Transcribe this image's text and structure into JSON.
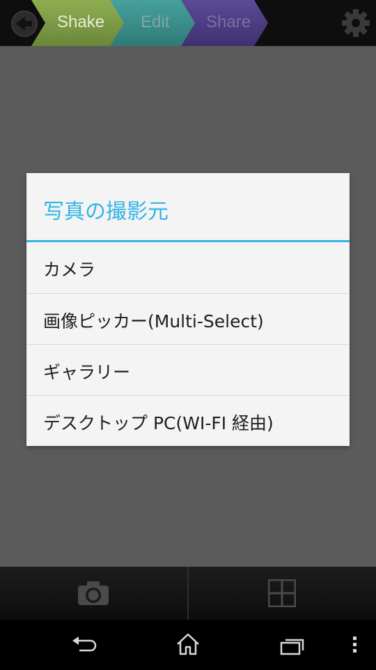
{
  "header": {
    "steps": [
      {
        "label": "Shake",
        "color": "#7e9a45"
      },
      {
        "label": "Edit",
        "color": "#3f8f8c"
      },
      {
        "label": "Share",
        "color": "#4f3f86"
      }
    ],
    "back_icon": "back-arrow-circle-icon",
    "settings_icon": "gear-icon"
  },
  "dialog": {
    "title": "写真の撮影元",
    "accent_color": "#33b5e5",
    "items": [
      {
        "label": "カメラ"
      },
      {
        "label": "画像ピッカー(Multi-Select)"
      },
      {
        "label": "ギャラリー"
      },
      {
        "label": "デスクトップ PC(WI-FI 経由)"
      }
    ]
  },
  "toolbar": {
    "left_icon": "camera-icon",
    "right_icon": "grid-icon"
  },
  "navbar": {
    "icons": [
      "back-icon",
      "home-icon",
      "recent-apps-icon",
      "overflow-menu-icon"
    ]
  }
}
